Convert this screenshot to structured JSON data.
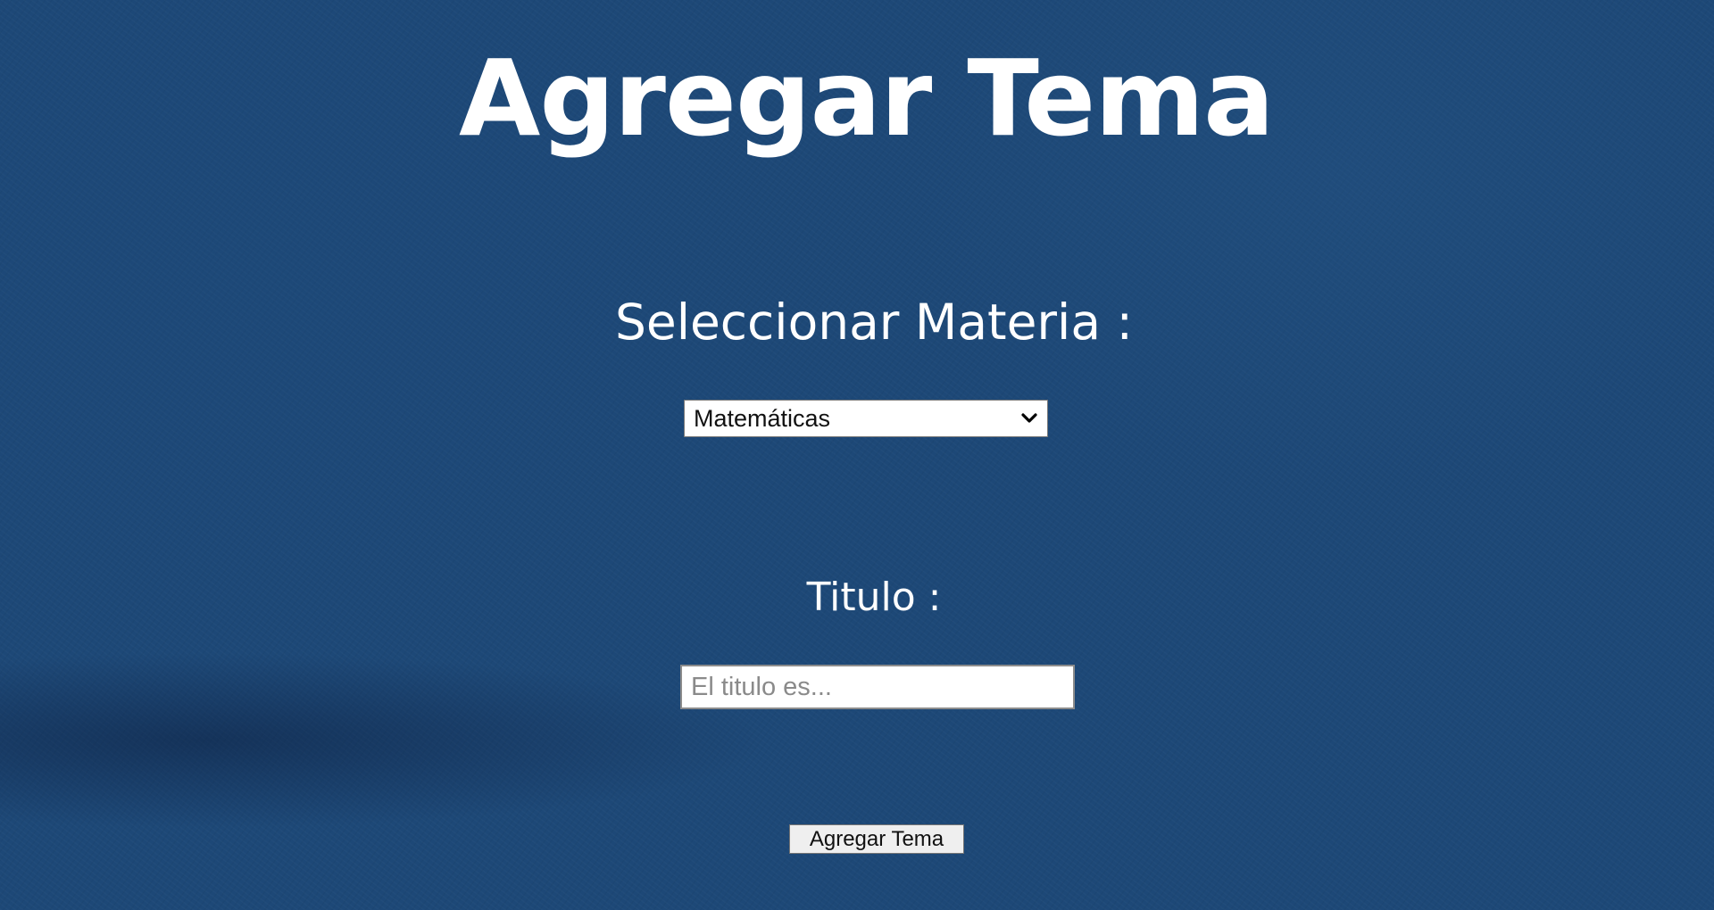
{
  "page": {
    "title": "Agregar Tema"
  },
  "form": {
    "subject_label": "Seleccionar Materia :",
    "subject_selected": "Matemáticas",
    "title_label": "Titulo :",
    "title_placeholder": "El titulo es...",
    "title_value": "",
    "submit_label": "Agregar Tema"
  },
  "icons": {
    "select_chevron": "chevron-down-icon"
  },
  "colors": {
    "background": "#1d4877",
    "text": "#ffffff",
    "button_bg": "#efefef"
  }
}
